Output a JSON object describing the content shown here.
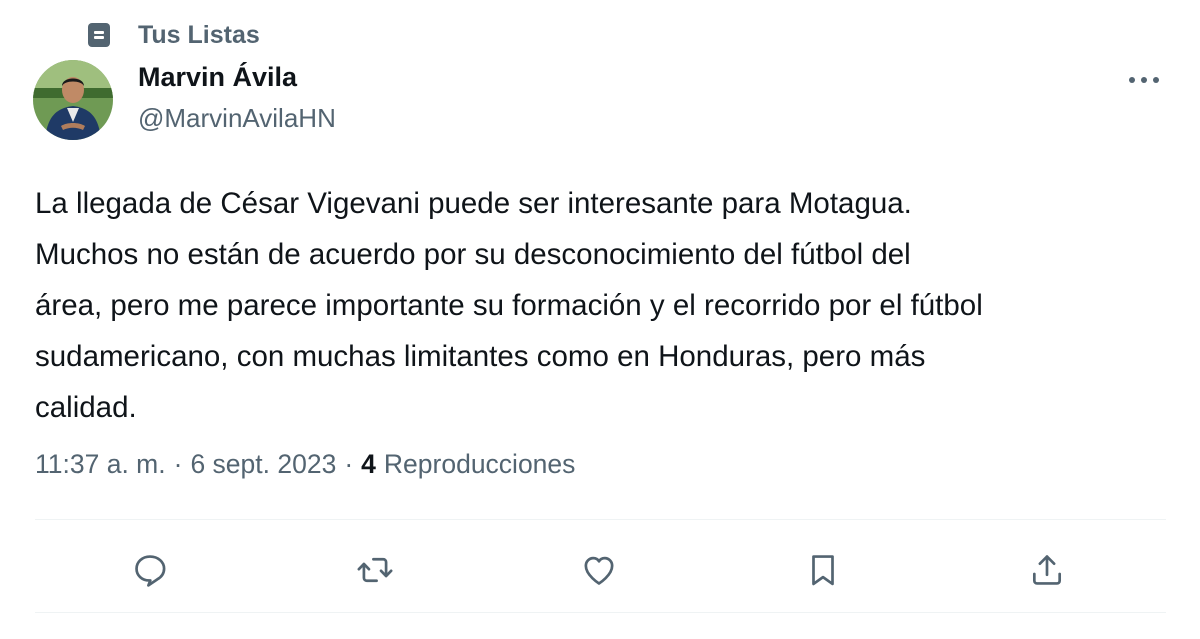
{
  "context": {
    "icon": "list-icon",
    "label": "Tus Listas"
  },
  "author": {
    "avatar": "avatar",
    "name": "Marvin Ávila",
    "handle": "@MarvinAvilaHN"
  },
  "tweet": {
    "lines": [
      "La llegada de César Vigevani puede ser interesante para Motagua.",
      "Muchos no están de acuerdo por su desconocimiento del fútbol del",
      "área, pero me parece importante su formación y el recorrido por el fútbol",
      "sudamericano, con muchas limitantes como en Honduras, pero más",
      "calidad."
    ],
    "time": "11:37 a. m.",
    "date": "6 sept. 2023",
    "separator": "·",
    "views_count": "4",
    "views_label": "Reproducciones"
  },
  "actions": [
    {
      "name": "reply",
      "icon": "reply-icon"
    },
    {
      "name": "retweet",
      "icon": "retweet-icon"
    },
    {
      "name": "like",
      "icon": "heart-icon"
    },
    {
      "name": "bookmark",
      "icon": "bookmark-icon"
    },
    {
      "name": "share",
      "icon": "share-icon"
    }
  ],
  "colors": {
    "primary_text": "#0f1419",
    "secondary_text": "#536471",
    "divider": "#eff3f4"
  }
}
